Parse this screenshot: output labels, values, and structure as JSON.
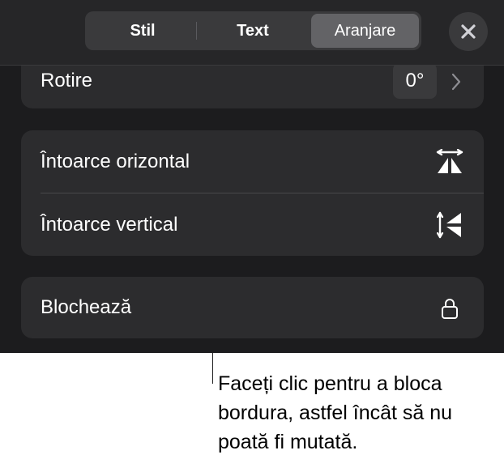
{
  "tabs": {
    "items": [
      {
        "label": "Stil",
        "selected": false
      },
      {
        "label": "Text",
        "selected": false
      },
      {
        "label": "Aranjare",
        "selected": true
      }
    ],
    "close_icon": "close-icon"
  },
  "rotation": {
    "label": "Rotire",
    "value": "0°",
    "chevron_icon": "chevron-right-icon"
  },
  "flip": {
    "horizontal_label": "Întoarce orizontal",
    "horizontal_icon": "flip-horizontal-icon",
    "vertical_label": "Întoarce vertical",
    "vertical_icon": "flip-vertical-icon"
  },
  "lock": {
    "label": "Blochează",
    "icon": "lock-icon"
  },
  "callout": {
    "text": "Faceți clic pentru a bloca bordura, astfel încât să nu poată fi mutată."
  },
  "colors": {
    "panel_background": "#1c1c1e",
    "group_background": "#2c2c2e",
    "selected_tab": "#636366",
    "text": "#ffffff"
  }
}
